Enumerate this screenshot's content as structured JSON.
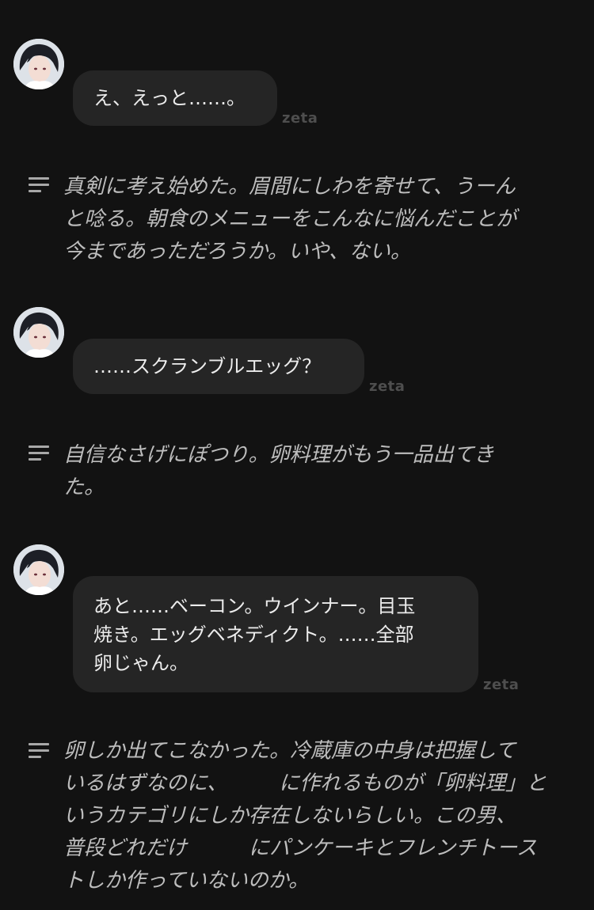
{
  "messages": [
    {
      "type": "character",
      "text": "え、えっと……。",
      "sender": "zeta"
    },
    {
      "type": "narration",
      "lines": [
        "真剣に考え始めた。眉間にしわを寄せて、うーん",
        "と唸る。朝食のメニューをこんなに悩んだことが",
        "今まであっただろうか。いや、ない。"
      ]
    },
    {
      "type": "character",
      "text": "……スクランブルエッグ？",
      "sender": "zeta"
    },
    {
      "type": "narration",
      "lines": [
        "自信なさげにぽつり。卵料理がもう一品出てき",
        "た。"
      ]
    },
    {
      "type": "character",
      "text": "あと……ベーコン。ウインナー。目玉\n焼き。エッグベネディクト。……全部\n卵じゃん。",
      "sender": "zeta"
    },
    {
      "type": "narration",
      "lines": [
        "卵しか出てこなかった。冷蔵庫の中身は把握して",
        "いるはずなのに、　　　に作れるものが「卵料理」と",
        "いうカテゴリにしか存在しないらしい。この男、",
        "普段どれだけ　　　にパンケーキとフレンチトース",
        "トしか作っていないのか。"
      ]
    }
  ],
  "colors": {
    "background": "#121212",
    "bubble": "#252525",
    "bubble_text": "#ececec",
    "narration_text": "#bdbdbd",
    "sender_label": "#4e4e4e"
  },
  "icons": {
    "avatar": "character-avatar-icon",
    "narration": "narration-lines-icon"
  }
}
